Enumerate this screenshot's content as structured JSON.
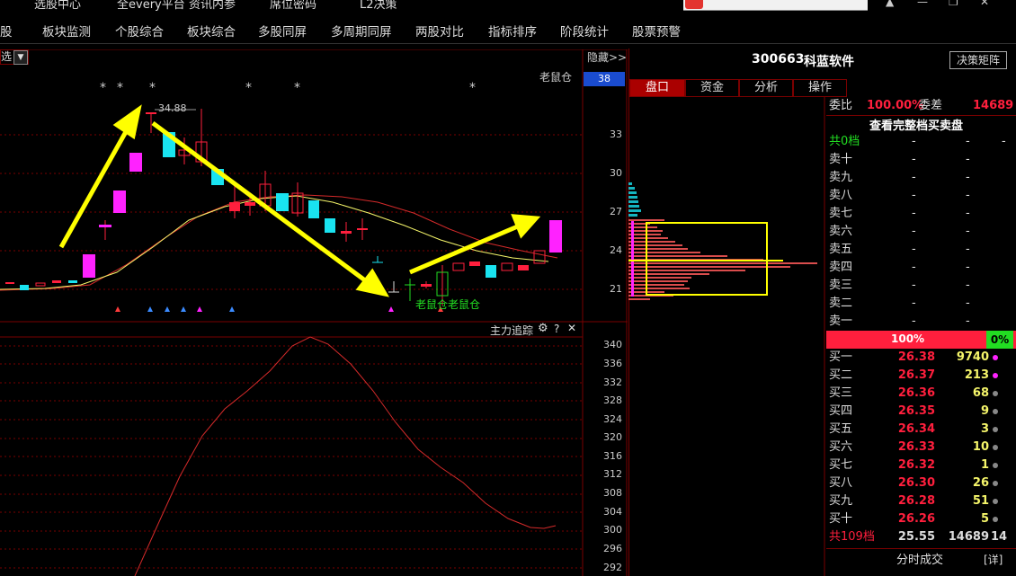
{
  "top": {
    "items": [
      "选股中心",
      "全every平台",
      "资讯内参",
      "席位密码",
      "L2决策"
    ],
    "window_controls": [
      "▲",
      "—",
      "❐",
      "✕"
    ]
  },
  "menu": [
    "股",
    "板块监测",
    "个股综合",
    "板块综合",
    "多股同屏",
    "多周期同屏",
    "两股对比",
    "指标排序",
    "阶段统计",
    "股票预警"
  ],
  "chart": {
    "selector_label": "选",
    "hide_label": "隐藏>>",
    "indicator_name": "老鼠仓",
    "current_tag": "38",
    "price_ticks": [
      "33",
      "30",
      "27",
      "24",
      "21"
    ],
    "high_label": "34.88",
    "mouse_label": "老鼠仓老鼠仓",
    "stars": [
      "*",
      "*",
      "*",
      "*",
      "*",
      "*"
    ]
  },
  "lower": {
    "title": "主力追踪",
    "gear": "⚙",
    "help": "?",
    "close": "✕",
    "ticks": [
      "340",
      "336",
      "332",
      "328",
      "324",
      "320",
      "316",
      "312",
      "308",
      "304",
      "300",
      "296",
      "292"
    ]
  },
  "stock": {
    "code": "300663",
    "name": "科蓝软件",
    "matrix_button": "决策矩阵"
  },
  "tabs": [
    "盘口",
    "资金",
    "分析",
    "操作"
  ],
  "orderbook": {
    "wei_bi_label": "委比",
    "wei_bi_value": "100.00%",
    "wei_cha_label": "委差",
    "wei_cha_value": "14689",
    "full_book_link": "查看完整档买卖盘",
    "sell_total_label": "共0档",
    "sells": [
      "卖十",
      "卖九",
      "卖八",
      "卖七",
      "卖六",
      "卖五",
      "卖四",
      "卖三",
      "卖二",
      "卖一"
    ],
    "dash": "-",
    "ratio_buy": "100%",
    "ratio_sell": "0%",
    "buys": [
      {
        "name": "买一",
        "price": "26.38",
        "vol": "9740"
      },
      {
        "name": "买二",
        "price": "26.37",
        "vol": "213"
      },
      {
        "name": "买三",
        "price": "26.36",
        "vol": "68"
      },
      {
        "name": "买四",
        "price": "26.35",
        "vol": "9"
      },
      {
        "name": "买五",
        "price": "26.34",
        "vol": "3"
      },
      {
        "name": "买六",
        "price": "26.33",
        "vol": "10"
      },
      {
        "name": "买七",
        "price": "26.32",
        "vol": "1"
      },
      {
        "name": "买八",
        "price": "26.30",
        "vol": "26"
      },
      {
        "name": "买九",
        "price": "26.28",
        "vol": "51"
      },
      {
        "name": "买十",
        "price": "26.26",
        "vol": "5"
      }
    ],
    "buy_total_label": "共109档",
    "buy_total_price": "25.55",
    "buy_total_vol": "14689",
    "buy_total_count": "14",
    "fenshi_label": "分时成交",
    "detail_label": "[详]"
  },
  "colors": {
    "up": "#ff1f3d",
    "down": "#19e3f0",
    "ma_yellow": "#f5f56a",
    "ma_red": "#d42a2a",
    "grid": "#7a0000",
    "green": "#22dd22",
    "magenta": "#ff22ff"
  }
}
